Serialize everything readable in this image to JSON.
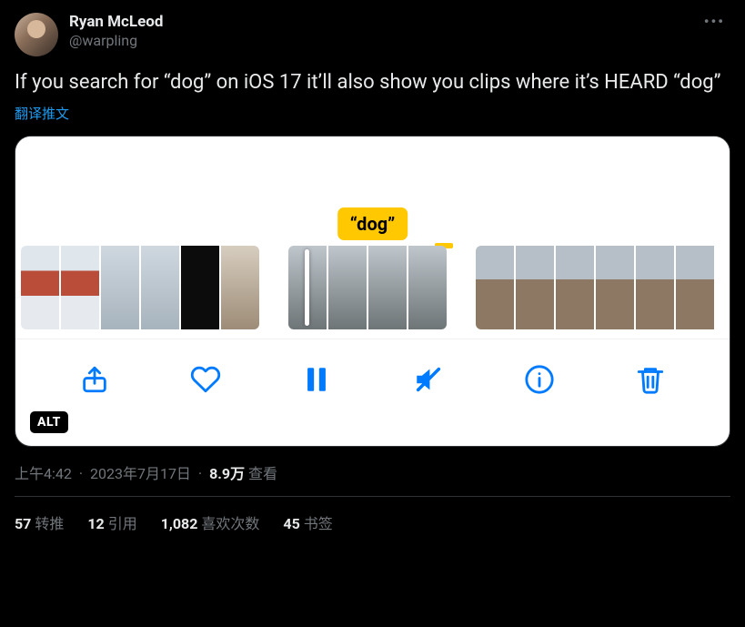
{
  "author": {
    "display_name": "Ryan McLeod",
    "handle": "@warpling"
  },
  "tweet_text": "If you search for “dog” on iOS 17 it’ll also show you clips where it’s HEARD “dog”",
  "translate_label": "翻译推文",
  "media": {
    "caption_tag": "“dog”",
    "alt_badge": "ALT"
  },
  "meta": {
    "time": "上午4:42",
    "date": "2023年7月17日",
    "views_number": "8.9万",
    "views_label": "查看"
  },
  "stats": {
    "retweets_count": "57",
    "retweets_label": "转推",
    "quotes_count": "12",
    "quotes_label": "引用",
    "likes_count": "1,082",
    "likes_label": "喜欢次数",
    "bookmarks_count": "45",
    "bookmarks_label": "书签"
  }
}
